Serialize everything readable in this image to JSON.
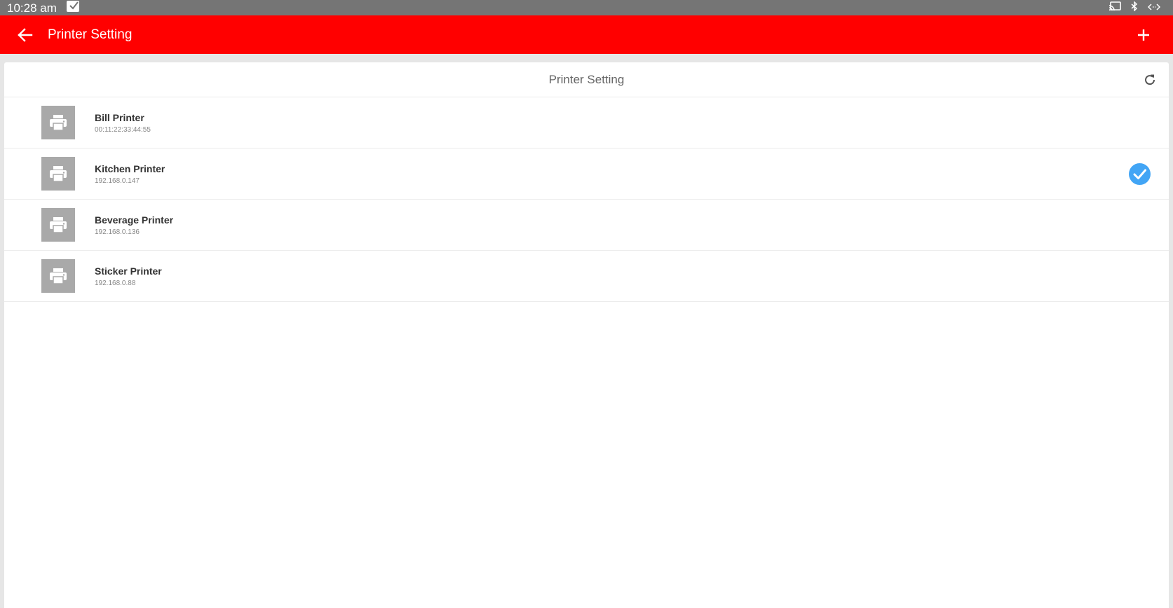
{
  "status_bar": {
    "time": "10:28 am",
    "icons": [
      "notification-check-icon",
      "cast-icon",
      "bluetooth-icon",
      "data-sync-icon"
    ]
  },
  "app_bar": {
    "title": "Printer Setting",
    "back_icon": "arrow-left-icon",
    "add_icon": "plus-icon",
    "color": "#ff0000"
  },
  "card": {
    "title": "Printer Setting",
    "refresh_icon": "refresh-icon"
  },
  "printers": [
    {
      "name": "Bill Printer",
      "address": "00:11:22:33:44:55",
      "selected": false
    },
    {
      "name": "Kitchen Printer",
      "address": "192.168.0.147",
      "selected": true
    },
    {
      "name": "Beverage Printer",
      "address": "192.168.0.136",
      "selected": false
    },
    {
      "name": "Sticker Printer",
      "address": "192.168.0.88",
      "selected": false
    }
  ],
  "colors": {
    "status_bar": "#757575",
    "accent_check": "#42a5f5",
    "printer_icon_bg": "#a9a9a9"
  }
}
